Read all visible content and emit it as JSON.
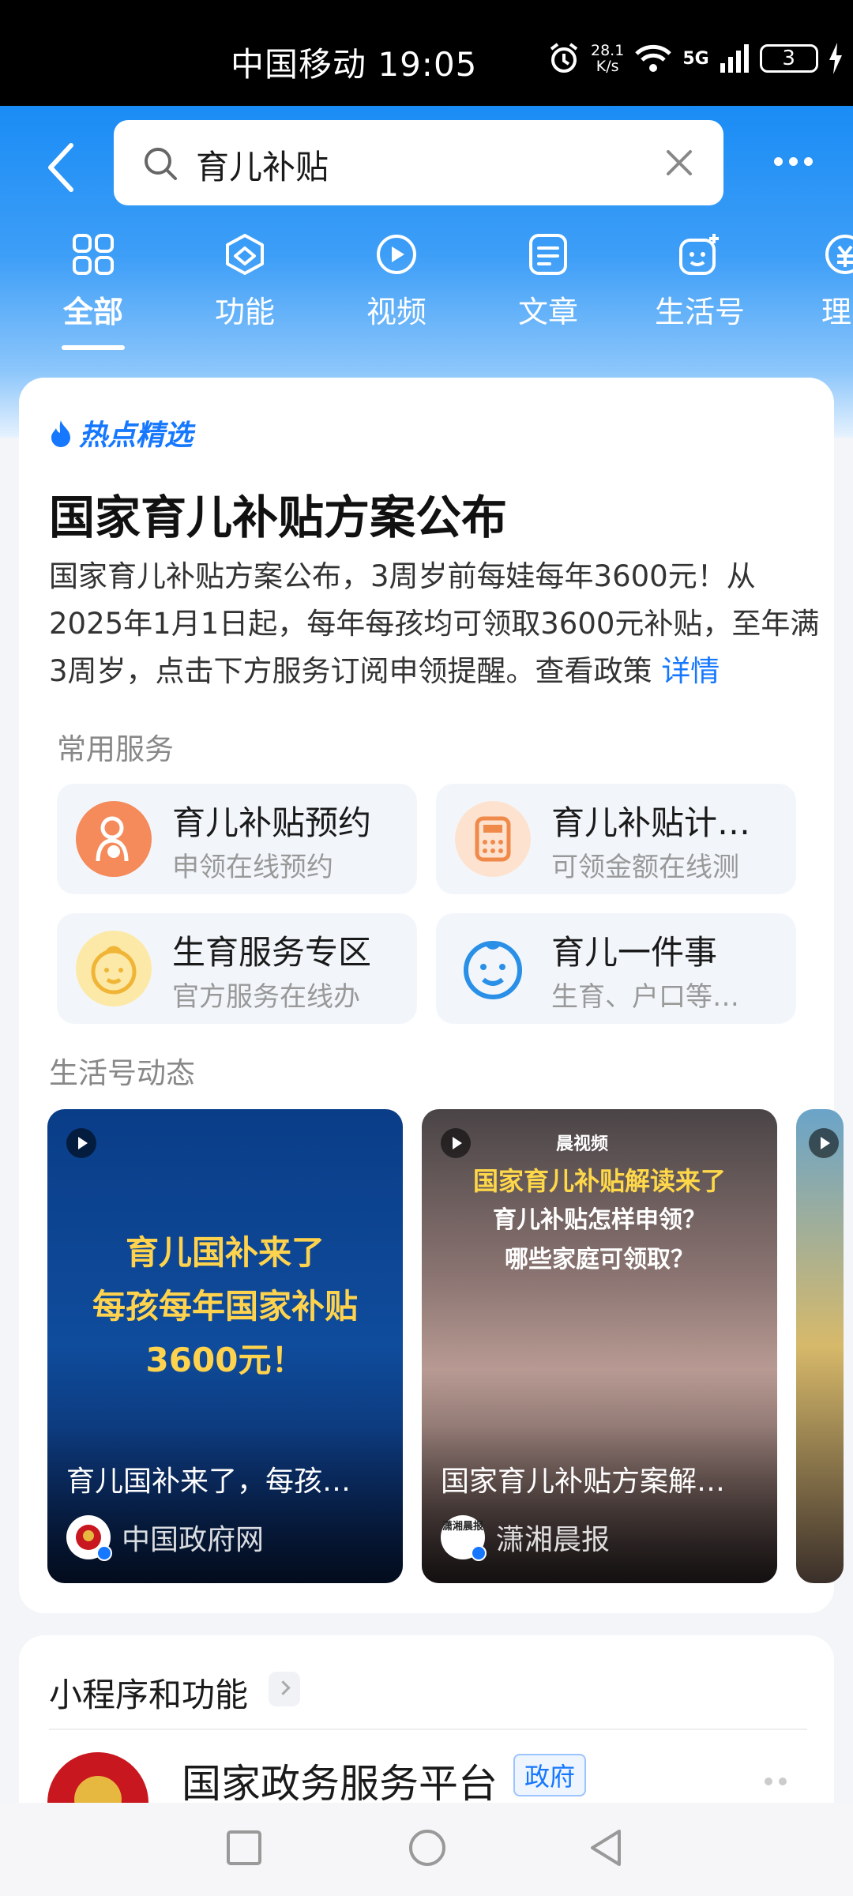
{
  "status_bar": {
    "carrier_time": "中国移动 19:05",
    "speed_value": "28.1",
    "speed_unit": "K/s",
    "network": "5G",
    "battery": "3"
  },
  "search": {
    "query": "育儿补贴"
  },
  "tabs": [
    {
      "label": "全部",
      "icon": "grid-icon",
      "active": true
    },
    {
      "label": "功能",
      "icon": "cube-icon"
    },
    {
      "label": "视频",
      "icon": "play-icon"
    },
    {
      "label": "文章",
      "icon": "article-icon"
    },
    {
      "label": "生活号",
      "icon": "lifeaccount-icon"
    },
    {
      "label": "理",
      "icon": "finance-icon"
    }
  ],
  "hot": {
    "tag": "热点精选",
    "headline": "国家育儿补贴方案公布",
    "description": "国家育儿补贴方案公布，3周岁前每娃每年3600元！从2025年1月1日起，每年每孩均可领取3600元补贴，至年满3周岁，点击下方服务订阅申领提醒。查看政策",
    "description_link": "详情"
  },
  "services": {
    "label": "常用服务",
    "items": [
      {
        "title": "育儿补贴预约",
        "sub": "申领在线预约",
        "color": "#f58a5a"
      },
      {
        "title": "育儿补贴计…",
        "sub": "可领金额在线测",
        "color": "#fde3cf"
      },
      {
        "title": "生育服务专区",
        "sub": "官方服务在线办",
        "color": "#fde9a7"
      },
      {
        "title": "育儿一件事",
        "sub": "生育、户口等…",
        "color": "#2a8fe6"
      }
    ]
  },
  "feed": {
    "label": "生活号动态",
    "videos": [
      {
        "overlay": [
          "育儿国补来了",
          "每孩每年国家补贴",
          "3600元！"
        ],
        "title": "育儿国补来了，每孩…",
        "author": "中国政府网"
      },
      {
        "brand": "晨视频",
        "overlay_line1": "国家育儿补贴解读来了",
        "overlay_line2": "育儿补贴怎样申领？",
        "overlay_line3": "哪些家庭可领取？",
        "title": "国家育儿补贴方案解…",
        "author": "潇湘晨报",
        "avatar_text": "潇湘晨报"
      }
    ]
  },
  "mini_programs": {
    "title": "小程序和功能",
    "first_item": {
      "title": "国家政务服务平台",
      "badge": "政府"
    }
  },
  "colors": {
    "brand_blue": "#1677ff",
    "header_blue": "#1a8cf5"
  }
}
